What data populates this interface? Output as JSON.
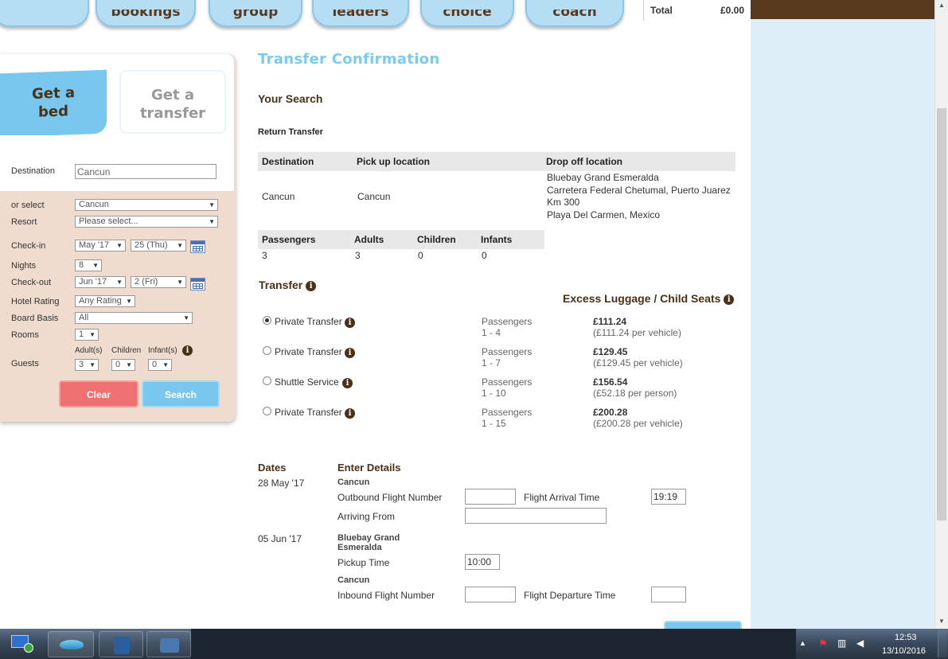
{
  "nav": {
    "tabs": [
      "bookings",
      "group",
      "leaders",
      "choice",
      "coach"
    ],
    "total_label": "Total",
    "total_value": "£0.00"
  },
  "search_panel": {
    "tab_bed": "Get a bed",
    "tab_transfer": "Get a transfer",
    "destination_label": "Destination",
    "destination_value": "Cancun",
    "or_select_label": "or select",
    "or_select_value": "Cancun",
    "resort_label": "Resort",
    "resort_value": "Please select...",
    "checkin_label": "Check-in",
    "checkin_month": "May '17",
    "checkin_day": "25 (Thu)",
    "nights_label": "Nights",
    "nights_value": "8",
    "checkout_label": "Check-out",
    "checkout_month": "Jun '17",
    "checkout_day": "2 (Fri)",
    "hotel_rating_label": "Hotel Rating",
    "hotel_rating_value": "Any Rating",
    "board_basis_label": "Board Basis",
    "board_basis_value": "All",
    "rooms_label": "Rooms",
    "rooms_value": "1",
    "guests_label": "Guests",
    "adults_label": "Adult(s)",
    "children_label": "Children",
    "infants_label": "Infant(s)",
    "adults_value": "3",
    "children_value": "0",
    "infants_value": "0",
    "clear_button": "Clear",
    "search_button": "Search",
    "colors": {
      "clear": "#ee7070",
      "search": "#79c6ee",
      "panel": "#f0dccf"
    }
  },
  "main": {
    "title": "Transfer Confirmation",
    "your_search": "Your Search",
    "transfer_type": "Return Transfer",
    "route_headers": [
      "Destination",
      "Pick up location",
      "Drop off location"
    ],
    "route_row": {
      "destination": "Cancun",
      "pickup": "Cancun",
      "dropoff_lines": [
        "Bluebay Grand Esmeralda",
        "Carretera Federal Chetumal, Puerto Juarez",
        "Km 300",
        "Playa Del Carmen, Mexico"
      ]
    },
    "pax_headers": [
      "Passengers",
      "Adults",
      "Children",
      "Infants"
    ],
    "pax_row": [
      "3",
      "3",
      "0",
      "0"
    ],
    "transfer_heading": "Transfer",
    "excess_heading": "Excess Luggage / Child Seats",
    "options": [
      {
        "name": "Private Transfer",
        "pax_label": "Passengers",
        "pax_range": "1 - 4",
        "price": "£111.24",
        "price_note": "(£111.24 per vehicle)",
        "selected": true
      },
      {
        "name": "Private Transfer",
        "pax_label": "Passengers",
        "pax_range": "1 - 7",
        "price": "£129.45",
        "price_note": "(£129.45 per vehicle)",
        "selected": false
      },
      {
        "name": "Shuttle Service",
        "pax_label": "Passengers",
        "pax_range": "1 - 10",
        "price": "£156.54",
        "price_note": "(£52.18 per person)",
        "selected": false
      },
      {
        "name": "Private Transfer",
        "pax_label": "Passengers",
        "pax_range": "1 - 15",
        "price": "£200.28",
        "price_note": "(£200.28 per vehicle)",
        "selected": false
      }
    ],
    "dates_heading": "Dates",
    "details_heading": "Enter Details",
    "outbound": {
      "date": "28 May '17",
      "place": "Cancun",
      "flight_label": "Outbound Flight Number",
      "flight_value": "",
      "arrival_label": "Flight Arrival Time",
      "arrival_value": "19:19",
      "arriving_from_label": "Arriving From",
      "arriving_from_value": ""
    },
    "inbound": {
      "date": "05 Jun '17",
      "place_line1": "Bluebay Grand",
      "place_line2": "Esmeralda",
      "pickup_label": "Pickup Time",
      "pickup_value": "10:00",
      "place2": "Cancun",
      "flight_label": "Inbound Flight Number",
      "flight_value": "",
      "departure_label": "Flight Departure Time",
      "departure_value": ""
    }
  },
  "taskbar": {
    "time": "12:53",
    "date": "13/10/2016"
  }
}
